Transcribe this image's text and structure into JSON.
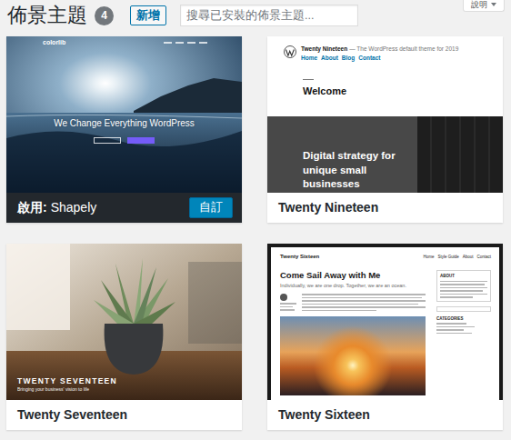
{
  "header": {
    "title": "佈景主題",
    "count": "4",
    "add_button": "新增",
    "search": {
      "placeholder": "搜尋已安裝的佈景主題..."
    },
    "help_tab": "說明"
  },
  "active_label": "啟用:",
  "customize_button": "自訂",
  "themes": [
    {
      "name": "Shapely",
      "active": true,
      "kind": "shapely",
      "preview": {
        "logo": "colorlib",
        "headline": "We Change Everything WordPress"
      }
    },
    {
      "name": "Twenty Nineteen",
      "active": false,
      "kind": "nineteen",
      "preview": {
        "site_title": "Twenty Nineteen",
        "tagline": "— The WordPress default theme for 2019",
        "nav": [
          "Home",
          "About",
          "Blog",
          "Contact"
        ],
        "heading": "Welcome",
        "banner": "Digital strategy for unique small businesses"
      }
    },
    {
      "name": "Twenty Seventeen",
      "active": false,
      "kind": "seventeen",
      "preview": {
        "site_title": "TWENTY SEVENTEEN",
        "tagline": "Bringing your business' vision to life"
      }
    },
    {
      "name": "Twenty Sixteen",
      "active": false,
      "kind": "sixteen",
      "preview": {
        "site_title": "Twenty Sixteen",
        "nav": [
          "Home",
          "Style Guide",
          "About",
          "Contact"
        ],
        "post_title": "Come Sail Away with Me",
        "excerpt": "Individually, we are one drop. Together, we are an ocean.",
        "sidebar": [
          "ABOUT",
          "CATEGORIES"
        ]
      }
    }
  ]
}
